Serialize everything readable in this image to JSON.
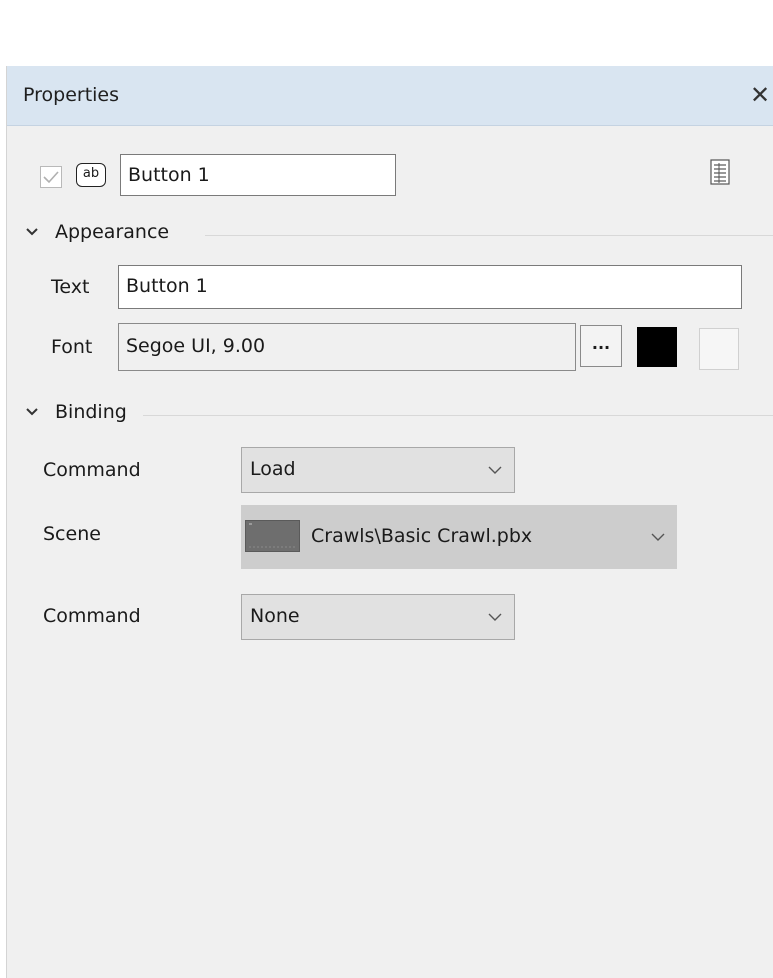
{
  "panel": {
    "title": "Properties",
    "close_icon": "close-icon"
  },
  "object": {
    "enabled_checked": true,
    "type_icon_label": "ab",
    "name_value": "Button 1",
    "properties_page_icon": "properties-page-icon"
  },
  "appearance": {
    "section_title": "Appearance",
    "text_label": "Text",
    "text_value": "Button 1",
    "font_label": "Font",
    "font_value": "Segoe UI, 9.00",
    "font_button_label": "...",
    "font_color": "#000000",
    "background_color": "#f6f6f6"
  },
  "binding": {
    "section_title": "Binding",
    "command1_label": "Command",
    "command1_value": "Load",
    "scene_label": "Scene",
    "scene_value": "Crawls\\Basic Crawl.pbx",
    "command2_label": "Command",
    "command2_value": "None"
  }
}
